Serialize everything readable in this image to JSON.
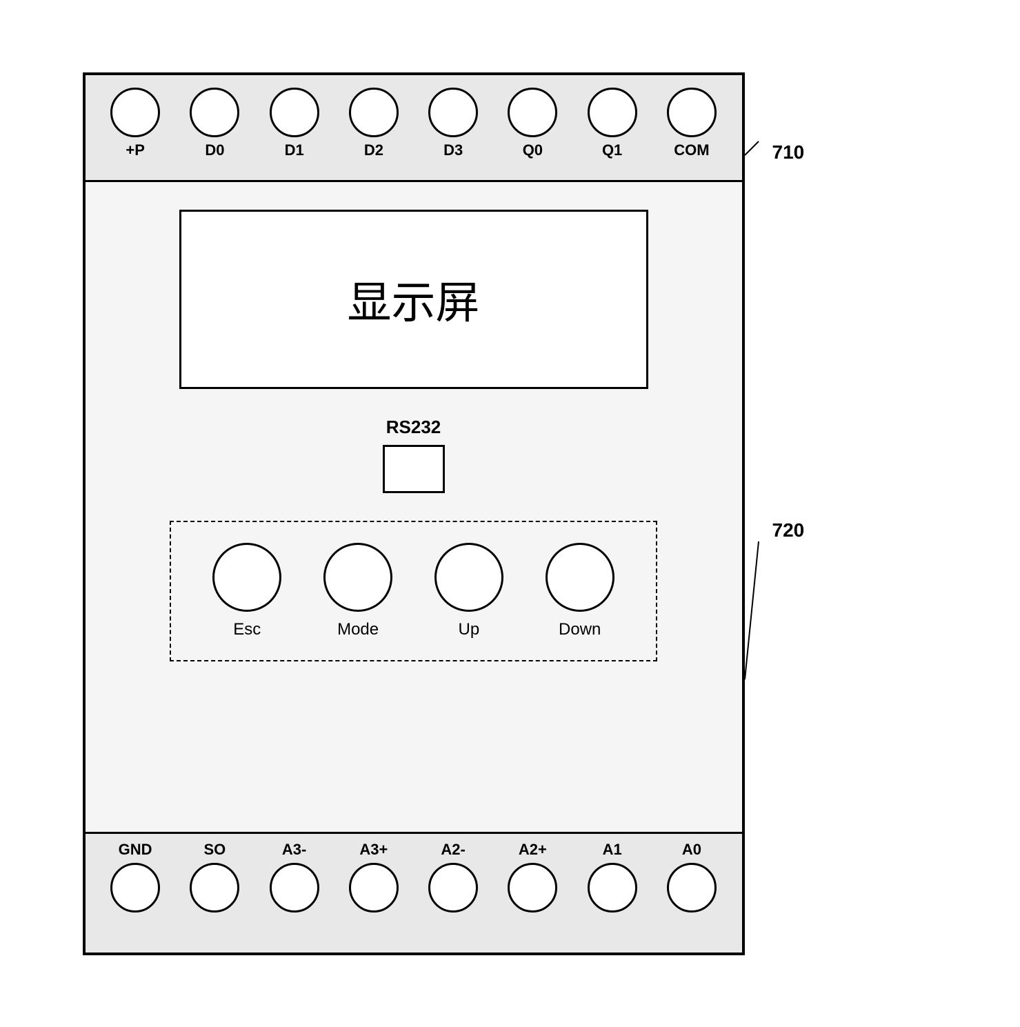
{
  "device": {
    "top_connectors": [
      {
        "label": "+P"
      },
      {
        "label": "D0"
      },
      {
        "label": "D1"
      },
      {
        "label": "D2"
      },
      {
        "label": "D3"
      },
      {
        "label": "Q0"
      },
      {
        "label": "Q1"
      },
      {
        "label": "COM"
      }
    ],
    "display": {
      "text": "显示屏"
    },
    "rs232": {
      "label": "RS232"
    },
    "buttons": [
      {
        "label": "Esc"
      },
      {
        "label": "Mode"
      },
      {
        "label": "Up"
      },
      {
        "label": "Down"
      }
    ],
    "bottom_connectors": [
      {
        "label": "GND"
      },
      {
        "label": "SO"
      },
      {
        "label": "A3-"
      },
      {
        "label": "A3+"
      },
      {
        "label": "A2-"
      },
      {
        "label": "A2+"
      },
      {
        "label": "A1"
      },
      {
        "label": "A0"
      }
    ]
  },
  "annotations": [
    {
      "id": "710",
      "label": "710"
    },
    {
      "id": "720",
      "label": "720"
    }
  ]
}
